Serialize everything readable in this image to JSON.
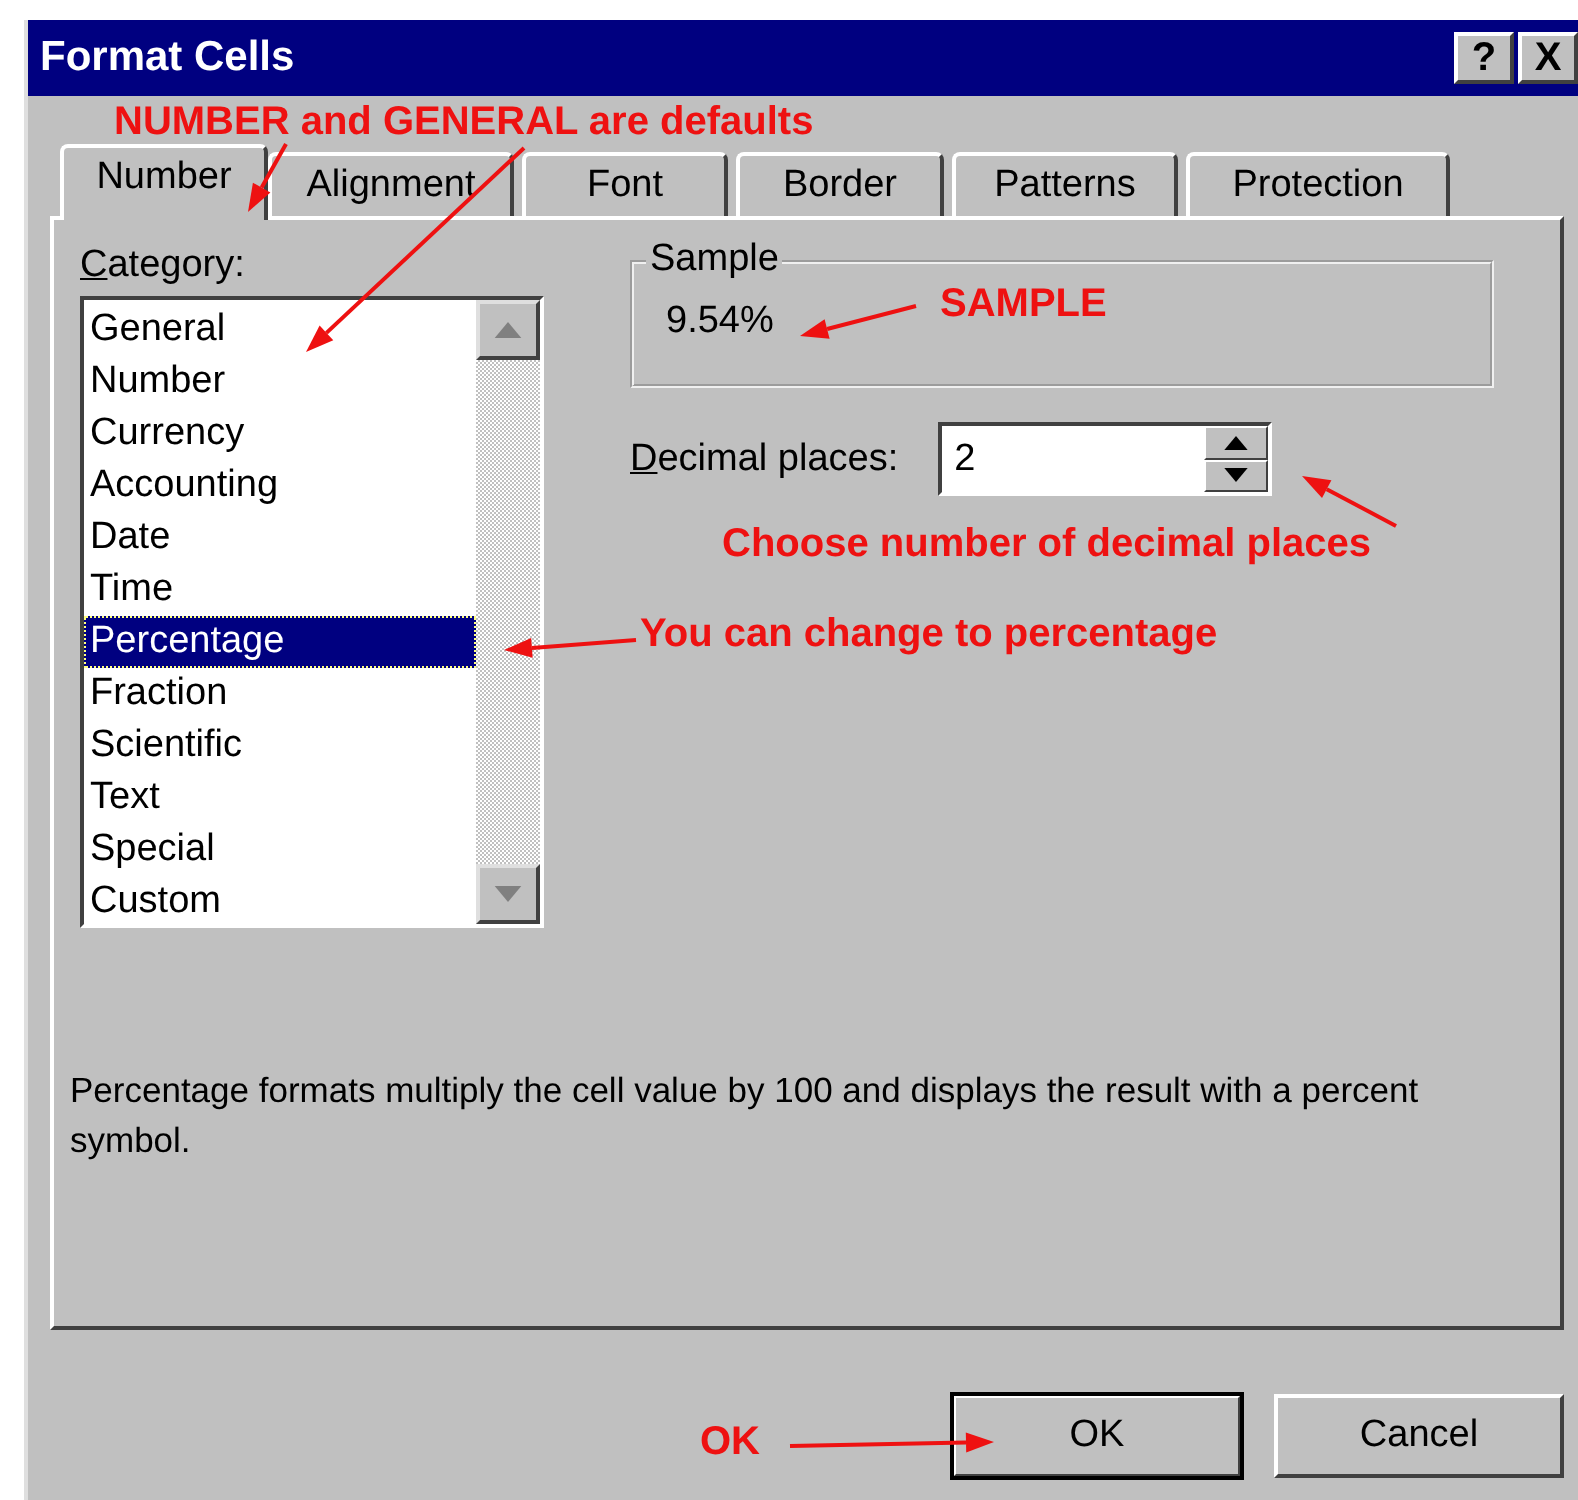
{
  "window": {
    "title": "Format Cells",
    "title_buttons": [
      "?",
      "X"
    ]
  },
  "tabs": [
    {
      "label": "Number",
      "selected": true
    },
    {
      "label": "Alignment",
      "selected": false
    },
    {
      "label": "Font",
      "selected": false
    },
    {
      "label": "Border",
      "selected": false
    },
    {
      "label": "Patterns",
      "selected": false
    },
    {
      "label": "Protection",
      "selected": false
    }
  ],
  "category": {
    "label": "Category:",
    "items": [
      {
        "label": "General",
        "selected": false
      },
      {
        "label": "Number",
        "selected": false
      },
      {
        "label": "Currency",
        "selected": false
      },
      {
        "label": "Accounting",
        "selected": false
      },
      {
        "label": "Date",
        "selected": false
      },
      {
        "label": "Time",
        "selected": false
      },
      {
        "label": "Percentage",
        "selected": true
      },
      {
        "label": "Fraction",
        "selected": false
      },
      {
        "label": "Scientific",
        "selected": false
      },
      {
        "label": "Text",
        "selected": false
      },
      {
        "label": "Special",
        "selected": false
      },
      {
        "label": "Custom",
        "selected": false
      }
    ]
  },
  "sample": {
    "label": "Sample",
    "value": "9.54%"
  },
  "decimal_places": {
    "label": "Decimal places:",
    "value": "2"
  },
  "description": "Percentage formats multiply the cell value by 100 and displays the result with a percent symbol.",
  "buttons": [
    {
      "label": "OK",
      "default": true
    },
    {
      "label": "Cancel",
      "default": false
    }
  ],
  "annotations": [
    {
      "text": "NUMBER and GENERAL are defaults"
    },
    {
      "text": "SAMPLE"
    },
    {
      "text": "Choose number of decimal places"
    },
    {
      "text": "You can change to percentage"
    },
    {
      "text": "OK"
    }
  ]
}
